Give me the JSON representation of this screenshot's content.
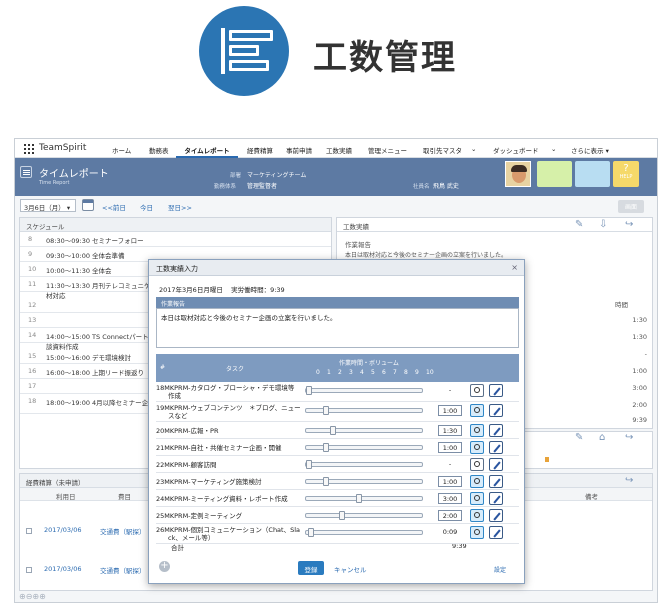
{
  "hero": {
    "title": "工数管理",
    "icon": "gantt-bars-icon",
    "color": "#2b75b3"
  },
  "nav": {
    "brand": "TeamSpirit",
    "tabs": [
      "ホーム",
      "勤務表",
      "タイムレポート",
      "経費精算",
      "事前申請",
      "工数実績",
      "管理メニュー",
      "取引先マスタ",
      "ダッシュボード",
      "さらに表示"
    ],
    "active": "タイムレポート"
  },
  "header": {
    "title": "タイムレポート",
    "subtitle": "Time Report",
    "dept_label": "部署",
    "dept_value": "マーケティングチーム",
    "workstyle_label": "勤務体系",
    "workstyle_value": "管理監督者",
    "employee_label": "社員名",
    "employee_value": "飛鳥 武史",
    "help": "HELP",
    "tile_colors": [
      "#d6f0a9",
      "#b8ddf2",
      "#f7e9a6",
      "#f5d96a"
    ]
  },
  "toolbar": {
    "date": "3月6日（月）",
    "prev": "<<前日",
    "today": "今日",
    "next": "翌日>>",
    "gray_btn": "画面"
  },
  "schedule": {
    "title": "スケジュール",
    "rows": [
      {
        "n": "8",
        "t": "08:30〜09:30 セミナーフォロー"
      },
      {
        "n": "9",
        "t": "09:30〜10:00 全体会準備"
      },
      {
        "n": "10",
        "t": "10:00〜11:30 全体会"
      },
      {
        "n": "11",
        "t": "11:30〜13:30 月刊テレコミュニケ"
      },
      {
        "n": "",
        "t": "材対応"
      },
      {
        "n": "12",
        "t": ""
      },
      {
        "n": "13",
        "t": ""
      },
      {
        "n": "14",
        "t": "14:00〜15:00 TS Connectパートナ"
      },
      {
        "n": "",
        "t": "談資料作成"
      },
      {
        "n": "15",
        "t": "15:00〜16:00 デモ環境検討"
      },
      {
        "n": "16",
        "t": "16:00〜18:00 上期リード振返り"
      },
      {
        "n": "17",
        "t": ""
      },
      {
        "n": "18",
        "t": "18:00〜19:00 4月以降セミナー企画"
      }
    ]
  },
  "results": {
    "title": "工数実績",
    "report_label": "作業報告",
    "report_text": "本日は取材対応と今後のセミナー企画の立案を行いました。",
    "time_header": "時間",
    "times": [
      "1:30",
      "1:30",
      "-",
      "1:00",
      "3:00",
      "2:00",
      "9:39"
    ]
  },
  "expense": {
    "title": "経費精算（未申請）",
    "cols": [
      "利用日",
      "費目",
      "備考"
    ],
    "rows": [
      {
        "date": "2017/03/06",
        "item": "交通費（駅探）"
      },
      {
        "date": "2017/03/06",
        "item": "交通費（駅探）"
      }
    ]
  },
  "modal": {
    "title": "工数実績入力",
    "date_line": "2017年3月6日月曜日",
    "actual_label": "実労働時間：",
    "actual_value": "9:39",
    "report_label": "作業報告",
    "report_text": "本日は取材対応と今後のセミナー企画の立案を行いました。",
    "col_num": "#",
    "col_task": "タスク",
    "col_volume": "作業時間・ボリューム",
    "scale": [
      "0",
      "1",
      "2",
      "3",
      "4",
      "5",
      "6",
      "7",
      "8",
      "9",
      "10"
    ],
    "tasks": [
      {
        "name1": "18MKPRM-カタログ・ブローシャ・デモ環境等",
        "name2": "作成",
        "value": "-",
        "boxed": false,
        "knob": 0,
        "blue": false
      },
      {
        "name1": "19MKPRM-ウェブコンテンツ　＊ブログ、ニュー",
        "name2": "スなど",
        "value": "1:00",
        "boxed": true,
        "knob": 0.15,
        "blue": true
      },
      {
        "name1": "20MKPRM-広報・PR",
        "name2": "",
        "value": "1:30",
        "boxed": true,
        "knob": 0.22,
        "blue": true
      },
      {
        "name1": "21MKPRM-自社・共催セミナー企画・開催",
        "name2": "",
        "value": "1:00",
        "boxed": true,
        "knob": 0.15,
        "blue": true
      },
      {
        "name1": "22MKPRM-顧客訪問",
        "name2": "",
        "value": "-",
        "boxed": false,
        "knob": 0,
        "blue": false
      },
      {
        "name1": "23MKPRM-マーケティング施策検討",
        "name2": "",
        "value": "1:00",
        "boxed": true,
        "knob": 0.15,
        "blue": true
      },
      {
        "name1": "24MKPRM-ミーティング資料・レポート作成",
        "name2": "",
        "value": "3:00",
        "boxed": true,
        "knob": 0.45,
        "blue": true
      },
      {
        "name1": "25MKPRM-定例ミーティング",
        "name2": "",
        "value": "2:00",
        "boxed": true,
        "knob": 0.3,
        "blue": true
      },
      {
        "name1": "26MKPRM-個別コミュニケーション（Chat、Sla",
        "name2": "ck、メール等）",
        "value": "0:09",
        "boxed": false,
        "knob": 0.02,
        "blue": true
      }
    ],
    "total_label": "合計",
    "total_value": "9:39",
    "save": "登録",
    "cancel": "キャンセル",
    "settings": "設定"
  }
}
